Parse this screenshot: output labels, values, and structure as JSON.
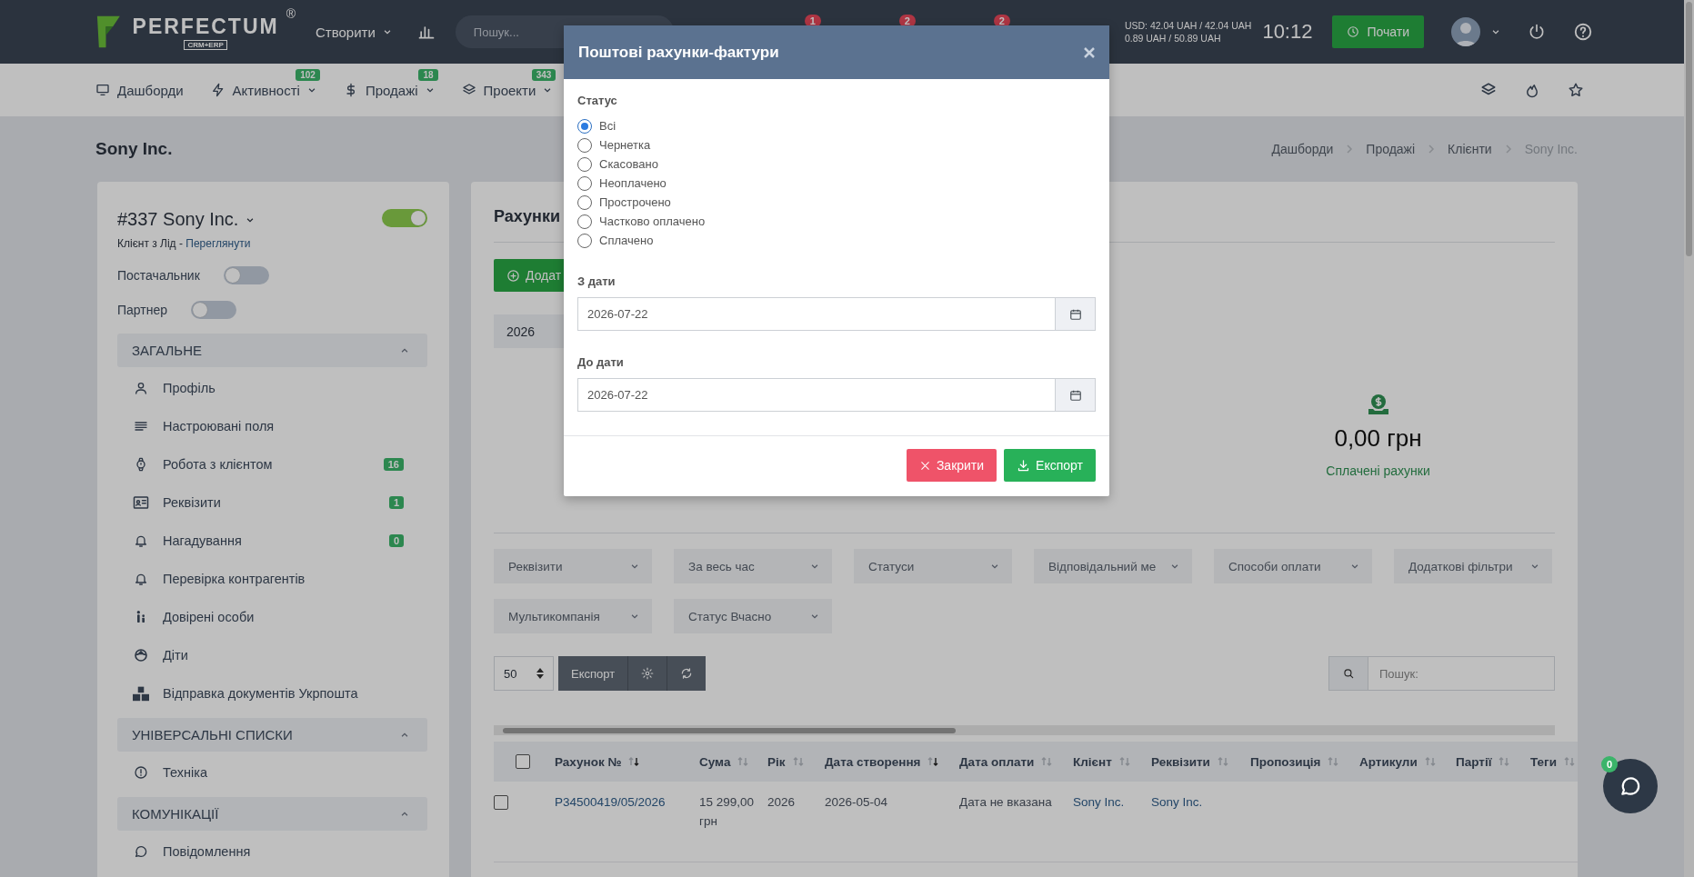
{
  "topbar": {
    "logo": "PERFECTUM",
    "logo_mark": "®",
    "logo_sub": "CRM+ERP",
    "create_menu": "Створити",
    "search_placeholder": "Пошук...",
    "notification_badges": [
      "1",
      "2",
      "2"
    ],
    "rates": [
      "USD: 42.04 UAH / 42.04 UAH",
      "0.89 UAH / 50.89 UAH"
    ],
    "time": "10:12",
    "start_button": "Почати"
  },
  "nav": {
    "items": [
      {
        "label": "Дашборди"
      },
      {
        "label": "Активності",
        "badge": "102"
      },
      {
        "label": "Продажі",
        "badge": "18"
      },
      {
        "label": "Проекти",
        "badge": "343"
      }
    ]
  },
  "page": {
    "title": "Sony Inc.",
    "breadcrumb": [
      {
        "label": "Дашборди",
        "current": false
      },
      {
        "label": "Продажі",
        "current": false
      },
      {
        "label": "Клієнти",
        "current": false
      },
      {
        "label": "Sony Inc.",
        "current": true
      }
    ]
  },
  "client": {
    "name": "#337 Sony Inc.",
    "type_text": "Клієнт з Лід - ",
    "view_link": "Переглянути",
    "active": true,
    "flags": [
      {
        "label": "Постачальник",
        "on": false
      },
      {
        "label": "Партнер",
        "on": false
      }
    ],
    "sections": [
      {
        "title": "ЗАГАЛЬНЕ",
        "expanded": true,
        "items": [
          {
            "label": "Профіль"
          },
          {
            "label": "Настроювані поля"
          },
          {
            "label": "Робота з клієнтом",
            "badge": "16"
          },
          {
            "label": "Реквізити",
            "badge": "1"
          },
          {
            "label": "Нагадування",
            "badge": "0"
          },
          {
            "label": "Перевірка контрагентів"
          },
          {
            "label": "Довірені особи"
          },
          {
            "label": "Діти"
          },
          {
            "label": "Відправка документів Укрпошта"
          }
        ]
      },
      {
        "title": "УНІВЕРСАЛЬНІ СПИСКИ",
        "expanded": true,
        "items": [
          {
            "label": "Техніка"
          }
        ]
      },
      {
        "title": "КОМУНІКАЦІЇ",
        "expanded": true,
        "items": [
          {
            "label": "Повідомлення"
          }
        ]
      }
    ]
  },
  "invoices": {
    "title": "Рахунки",
    "add_button": "Додат",
    "year": "2026",
    "stat": {
      "amount": "0,00 грн",
      "label": "Сплачені рахунки"
    },
    "filters": [
      "Реквізити",
      "За весь час",
      "Статуси",
      "Відповідальний ме",
      "Способи оплати",
      "Додаткові фільтри",
      "Мультикомпанія",
      "Статус Вчасно"
    ],
    "page_size": "50",
    "export_button": "Експорт",
    "search_placeholder": "Пошук:",
    "table": {
      "select_all_checked": false,
      "columns": [
        {
          "label": "Рахунок №",
          "sorted": true
        },
        {
          "label": "Сума",
          "sorted": false
        },
        {
          "label": "Рік",
          "sorted": false
        },
        {
          "label": "Дата створення",
          "sorted": true
        },
        {
          "label": "Дата оплати",
          "sorted": false
        },
        {
          "label": "Клієнт",
          "sorted": false
        },
        {
          "label": "Реквізити",
          "sorted": false
        },
        {
          "label": "Пропозиція",
          "sorted": false
        },
        {
          "label": "Артикули",
          "sorted": false
        },
        {
          "label": "Партії",
          "sorted": false
        },
        {
          "label": "Теги",
          "sorted": false
        }
      ],
      "rows": [
        {
          "checked": false,
          "cells": [
            {
              "text": "P34500419/05/2026",
              "kind": "link"
            },
            {
              "text": "15 299,00 грн",
              "kind": "text"
            },
            {
              "text": "2026",
              "kind": "text"
            },
            {
              "text": "2026-05-04",
              "kind": "text"
            },
            {
              "text": "Дата не вказана",
              "kind": "text"
            },
            {
              "text": "Sony Inc.",
              "kind": "link"
            },
            {
              "text": "Sony Inc.",
              "kind": "link"
            }
          ]
        }
      ]
    }
  },
  "modal": {
    "title": "Поштові рахунки-фактури",
    "status_label": "Статус",
    "statuses": [
      {
        "label": "Всі",
        "selected": true
      },
      {
        "label": "Чернетка",
        "selected": false
      },
      {
        "label": "Скасовано",
        "selected": false
      },
      {
        "label": "Неоплачено",
        "selected": false
      },
      {
        "label": "Прострочено",
        "selected": false
      },
      {
        "label": "Частково оплачено",
        "selected": false
      },
      {
        "label": "Сплачено",
        "selected": false
      }
    ],
    "from_label": "З дати",
    "from_value": "2026-07-22",
    "to_label": "До дати",
    "to_value": "2026-07-22",
    "close_button": "Закрити",
    "export_button": "Експорт"
  },
  "chat": {
    "badge": "0"
  }
}
